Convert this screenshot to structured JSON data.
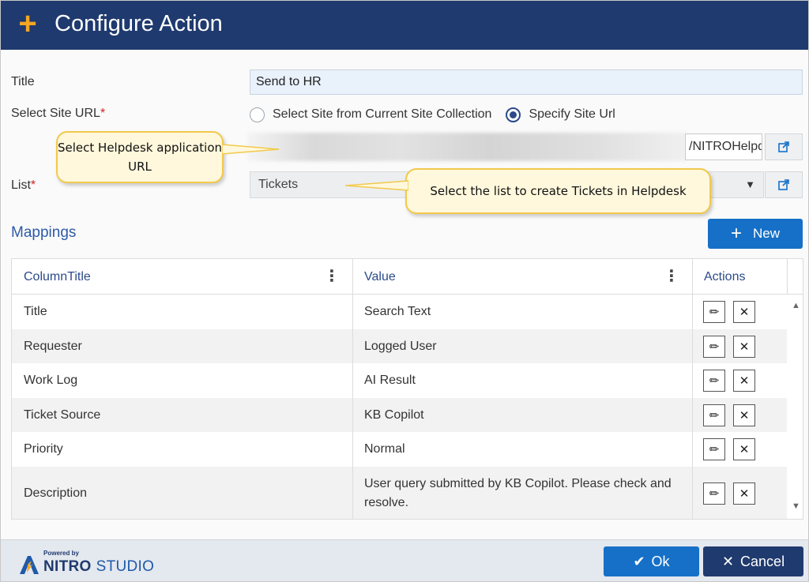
{
  "header": {
    "title": "Configure Action"
  },
  "form": {
    "title_label": "Title",
    "title_value": "Send to HR",
    "site_url_label": "Select Site URL",
    "required_mark": "*",
    "radio_current": "Select Site from Current Site Collection",
    "radio_specify": "Specify Site Url",
    "site_url_value": "/NITROHelpd",
    "list_label": "List",
    "list_value": "Tickets"
  },
  "callouts": {
    "helpdesk_url": "Select Helpdesk application URL",
    "list_tickets": "Select the list to create Tickets in Helpdesk"
  },
  "mappings": {
    "title": "Mappings",
    "new_label": "New",
    "columns": [
      "ColumnTitle",
      "Value",
      "Actions"
    ],
    "rows": [
      {
        "column": "Title",
        "value": "Search Text"
      },
      {
        "column": "Requester",
        "value": "Logged User"
      },
      {
        "column": "Work Log",
        "value": "AI Result"
      },
      {
        "column": "Ticket Source",
        "value": "KB Copilot"
      },
      {
        "column": "Priority",
        "value": "Normal"
      },
      {
        "column": "Description",
        "value": "User query submitted by KB Copilot. Please check and resolve."
      }
    ]
  },
  "footer": {
    "powered_by": "Powered by",
    "brand_nitro": "NITRO",
    "brand_studio": "STUDIO",
    "ok_label": "Ok",
    "cancel_label": "Cancel"
  },
  "colors": {
    "header_bg": "#1f3a6e",
    "accent_orange": "#f5a623",
    "primary_blue": "#1670c7",
    "link_blue": "#2e5aa8"
  }
}
